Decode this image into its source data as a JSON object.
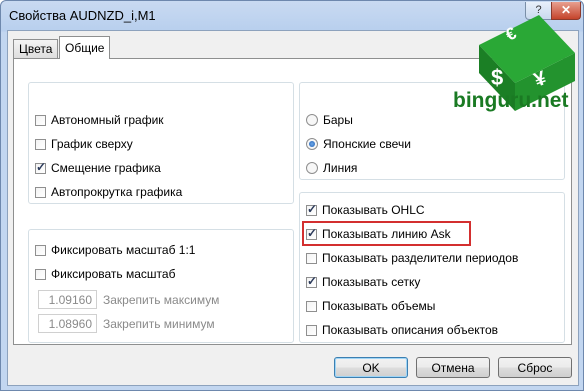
{
  "window": {
    "title": "Свойства AUDNZD_i,M1",
    "help_label": "?",
    "close_label": "✕"
  },
  "tabs": [
    {
      "label": "Цвета",
      "active": false
    },
    {
      "label": "Общие",
      "active": true
    }
  ],
  "chart_options": [
    {
      "label": "Автономный график",
      "checked": false
    },
    {
      "label": "График сверху",
      "checked": false
    },
    {
      "label": "Смещение графика",
      "checked": true
    },
    {
      "label": "Автопрокрутка графика",
      "checked": false
    }
  ],
  "scale": {
    "fix_1_1": {
      "label": "Фиксировать масштаб 1:1",
      "checked": false
    },
    "fix": {
      "label": "Фиксировать масштаб",
      "checked": false
    },
    "max": {
      "value": "1.09160",
      "label": "Закрепить максимум"
    },
    "min": {
      "value": "1.08960",
      "label": "Закрепить минимум"
    }
  },
  "chart_type": [
    {
      "label": "Бары",
      "selected": false
    },
    {
      "label": "Японские свечи",
      "selected": true
    },
    {
      "label": "Линия",
      "selected": false
    }
  ],
  "display_options": [
    {
      "label": "Показывать OHLC",
      "checked": true
    },
    {
      "label": "Показывать линию Ask",
      "checked": true,
      "highlighted": true
    },
    {
      "label": "Показывать разделители периодов",
      "checked": false
    },
    {
      "label": "Показывать сетку",
      "checked": true
    },
    {
      "label": "Показывать объемы",
      "checked": false
    },
    {
      "label": "Показывать описания объектов",
      "checked": false
    }
  ],
  "buttons": {
    "ok": "OK",
    "cancel": "Отмена",
    "reset": "Сброс"
  },
  "watermark": {
    "text": "binguru.net",
    "icon_symbols": [
      "€",
      "$",
      "¥"
    ]
  },
  "colors": {
    "highlight": "#d32f2f",
    "logo_green": "#1a8a2a"
  }
}
